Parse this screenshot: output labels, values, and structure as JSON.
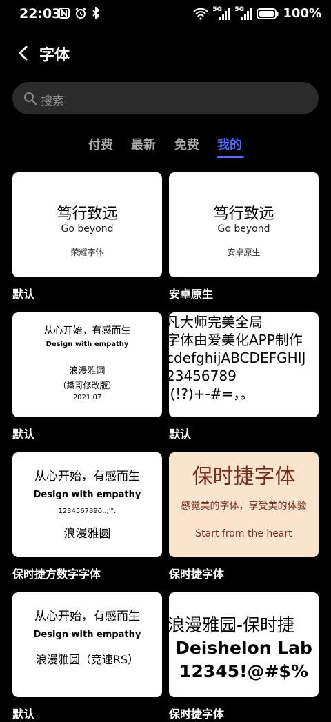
{
  "status": {
    "time": "22:03",
    "battery": "100%",
    "signal1": "5G",
    "signal2": "5G"
  },
  "header": {
    "title": "字体"
  },
  "search": {
    "placeholder": "搜索"
  },
  "tabs": [
    {
      "label": "付费"
    },
    {
      "label": "最新"
    },
    {
      "label": "免费"
    },
    {
      "label": "我的"
    }
  ],
  "active_tab": "我的",
  "fonts": [
    {
      "caption": "默认",
      "lines": [
        "笃行致远",
        "Go beyond",
        "荣耀字体"
      ]
    },
    {
      "caption": "安卓原生",
      "lines": [
        "笃行致远",
        "Go beyond",
        "安卓原生"
      ]
    },
    {
      "caption": "默认",
      "lines": [
        "从心开始，有感而生",
        "Design with empathy",
        "浪漫雅圆",
        "（鐵哥修改版）",
        "2021.07"
      ]
    },
    {
      "caption": "默认",
      "lines": [
        "凡大师完美全局",
        "字体由爱美化APP制作",
        "cdefghijABCDEFGHIJ",
        "23456789",
        "'(!?)+-#=，。"
      ]
    },
    {
      "caption": "保时捷方数字字体",
      "lines": [
        "从心开始，有感而生",
        "Design with empathy",
        "1234567890,.;'\":",
        "浪漫雅圆"
      ]
    },
    {
      "caption": "保时捷字体",
      "lines": [
        "保时捷字体",
        "感觉美的字体，享受美的体验",
        "Start from the heart"
      ]
    },
    {
      "caption": "默认",
      "lines": [
        "从心开始，有感而生",
        "Design with empathy",
        "浪漫雅圆（竞速RS）"
      ]
    },
    {
      "caption": "保时捷字体",
      "lines": [
        "浪漫雅园-保时捷",
        "Deishelon Lab",
        "12345!@#$%"
      ]
    }
  ],
  "colors": {
    "accent": "#4f6cff",
    "background": "#000000",
    "card": "#ffffff",
    "porsche_card": "#fae4cd",
    "porsche_title": "#7a2c1e"
  }
}
